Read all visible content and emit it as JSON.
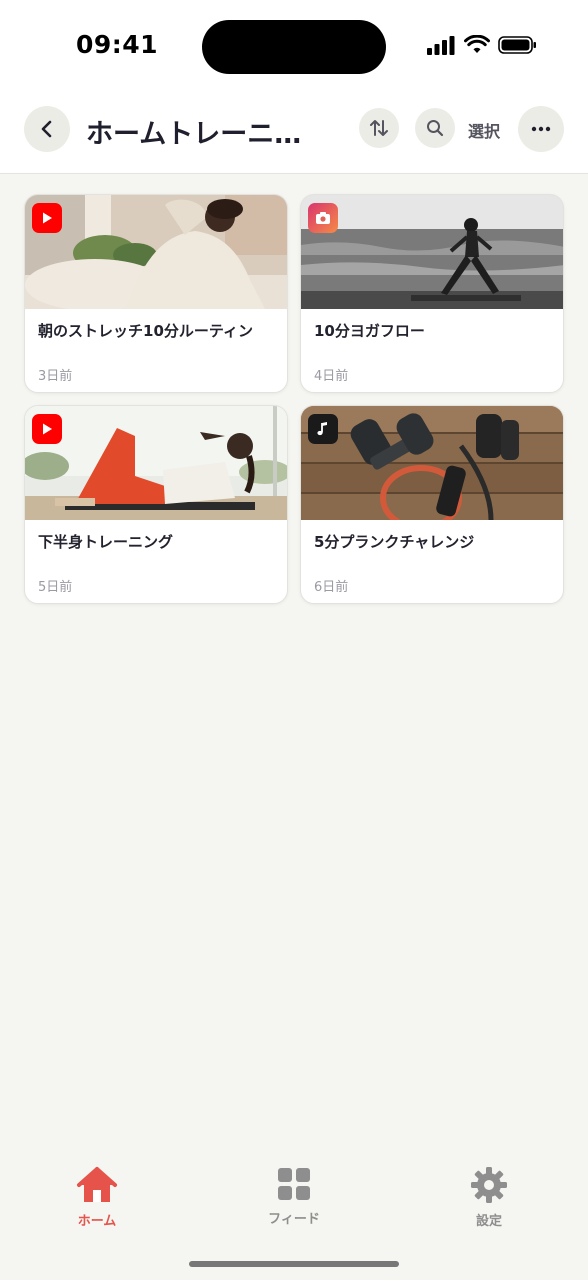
{
  "status_bar": {
    "time": "09:41"
  },
  "header": {
    "title": "ホームトレーニ…",
    "select_label": "選択",
    "icons": {
      "back": "chevron-left-icon",
      "sort": "sort-arrows-icon",
      "search": "search-icon",
      "more": "more-horizontal-icon"
    }
  },
  "cards": [
    {
      "title": "朝のストレッチ10分ルーティン",
      "date": "3日前",
      "source": "youtube"
    },
    {
      "title": "10分ヨガフロー",
      "date": "4日前",
      "source": "instagram"
    },
    {
      "title": "下半身トレーニング",
      "date": "5日前",
      "source": "youtube"
    },
    {
      "title": "5分プランクチャレンジ",
      "date": "6日前",
      "source": "music"
    }
  ],
  "tabs": [
    {
      "label": "ホーム",
      "icon": "home-icon",
      "active": true
    },
    {
      "label": "フィード",
      "icon": "grid-icon",
      "active": false
    },
    {
      "label": "設定",
      "icon": "gear-icon",
      "active": false
    }
  ],
  "colors": {
    "accent": "#e5534b",
    "inactive": "#8e8e8e",
    "background": "#f5f5f1",
    "youtube": "#ff0000"
  }
}
